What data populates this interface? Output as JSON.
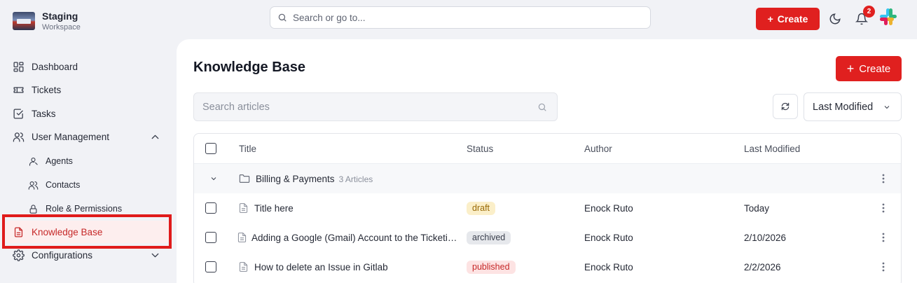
{
  "workspace": {
    "name": "Staging",
    "subtitle": "Workspace"
  },
  "sidebar": {
    "items": [
      {
        "label": "Dashboard",
        "icon": "dashboard-icon"
      },
      {
        "label": "Tickets",
        "icon": "ticket-icon"
      },
      {
        "label": "Tasks",
        "icon": "checkbox-icon"
      },
      {
        "label": "User Management",
        "icon": "users-icon",
        "expanded": true,
        "children": [
          {
            "label": "Agents",
            "icon": "user-icon"
          },
          {
            "label": "Contacts",
            "icon": "contacts-icon"
          },
          {
            "label": "Role & Permissions",
            "icon": "lock-icon"
          }
        ]
      },
      {
        "label": "Knowledge Base",
        "icon": "document-icon",
        "active": true
      },
      {
        "label": "Configurations",
        "icon": "gear-icon",
        "expanded": false
      }
    ]
  },
  "topbar": {
    "search_placeholder": "Search or go to...",
    "create_label": "Create",
    "notification_count": "2"
  },
  "page": {
    "title": "Knowledge Base",
    "create_label": "Create",
    "search_placeholder": "Search articles",
    "sort_label": "Last Modified"
  },
  "table": {
    "columns": [
      "Title",
      "Status",
      "Author",
      "Last Modified"
    ],
    "group": {
      "name": "Billing & Payments",
      "count": "3 Articles"
    },
    "rows": [
      {
        "title": "Title here",
        "status": "draft",
        "author": "Enock Ruto",
        "modified": "Today"
      },
      {
        "title": "Adding a Google (Gmail) Account to the Ticketing System",
        "status": "archived",
        "author": "Enock Ruto",
        "modified": "2/10/2026"
      },
      {
        "title": "How to delete an Issue in Gitlab",
        "status": "published",
        "author": "Enock Ruto",
        "modified": "2/2/2026"
      }
    ]
  },
  "colors": {
    "accent": "#e0201f",
    "active_bg": "#fdeeee",
    "highlight_box": "#e01b1b",
    "draft": "#fbefc9",
    "archived": "#e6e8ec",
    "published": "#fde3e3"
  }
}
